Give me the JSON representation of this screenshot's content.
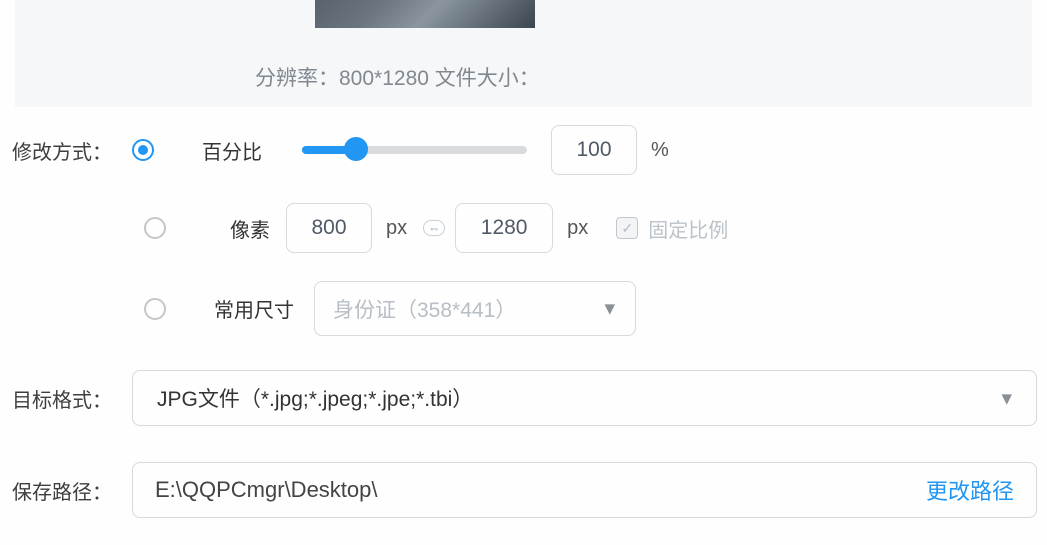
{
  "preview": {
    "info_label": "分辨率：",
    "resolution": "800*1280",
    "size_label": " 文件大小："
  },
  "resize": {
    "label": "修改方式：",
    "percent": {
      "label": "百分比",
      "value": "100",
      "unit": "%"
    },
    "pixel": {
      "label": "像素",
      "width": "800",
      "height": "1280",
      "unit_w": "px",
      "unit_h": "px",
      "lock_label": "固定比例"
    },
    "preset": {
      "label": "常用尺寸",
      "placeholder": "身份证（358*441）"
    }
  },
  "format": {
    "label": "目标格式：",
    "value": "JPG文件（*.jpg;*.jpeg;*.jpe;*.tbi）"
  },
  "path": {
    "label": "保存路径：",
    "value": "E:\\QQPCmgr\\Desktop\\",
    "change": "更改路径"
  }
}
